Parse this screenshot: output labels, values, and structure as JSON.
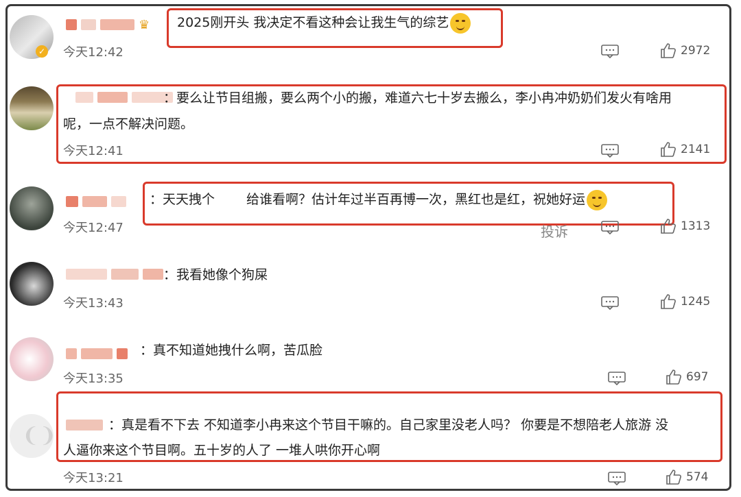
{
  "comments": [
    {
      "text": "2025刚开头 我决定不看这种会让我生气的综艺",
      "time": "今天12:42",
      "likes": "2972",
      "icon_user_badge": "vip-badge-icon",
      "crown_icon": "crown-icon",
      "emoji": "laughing-crying-emoji-icon"
    },
    {
      "text_line1": "：要么让节目组搬，要么两个小的搬，难道六七十岁去搬么，李小冉冲奶奶们发火有啥用",
      "text_line2": "呢，一点不解决问题。",
      "time": "今天12:41",
      "likes": "2141"
    },
    {
      "text_a": "：天天拽个",
      "text_b": "给谁看啊？估计年过半百再博一次，黑红也是红，祝她好运",
      "time": "今天12:47",
      "likes": "1313",
      "report": "投诉",
      "emoji": "smile-emoji-icon"
    },
    {
      "text": "：我看她像个狗屎",
      "time": "今天13:43",
      "likes": "1245"
    },
    {
      "text": "：真不知道她拽什么啊，苦瓜脸",
      "time": "今天13:35",
      "likes": "697"
    },
    {
      "text_line1": "：真是看不下去 不知道李小冉来这个节目干嘛的。自己家里没老人吗？ 你要是不想陪老人旅游 没",
      "text_line2": "人逼你来这个节目啊。五十岁的人了 一堆人哄你开心啊",
      "time": "今天13:21",
      "likes": "574"
    }
  ],
  "colors": {
    "highlight": "#d93a2b",
    "frame": "#3a3a3a",
    "blur_pink": "#f2b7a8",
    "blur_red": "#e8806a"
  }
}
